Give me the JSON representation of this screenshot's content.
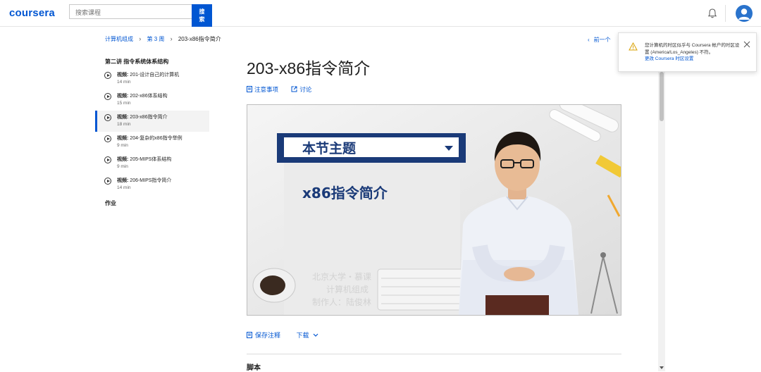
{
  "header": {
    "logo": "coursera",
    "search_placeholder": "搜索课程",
    "search_button": "搜索"
  },
  "breadcrumb": {
    "items": [
      "计算机组成",
      "第 3 周",
      "203-x86指令简介"
    ],
    "prev": "前一个"
  },
  "sidebar": {
    "section_title": "第二讲 指令系统体系结构",
    "items": [
      {
        "prefix": "视频:",
        "label": "201-设计自己的计算机",
        "duration": "14 min"
      },
      {
        "prefix": "视频:",
        "label": "202-x86体系结构",
        "duration": "15 min"
      },
      {
        "prefix": "视频:",
        "label": "203-x86指令简介",
        "duration": "18 min"
      },
      {
        "prefix": "视频:",
        "label": "204-复杂的x86指令举例",
        "duration": "9 min"
      },
      {
        "prefix": "视频:",
        "label": "205-MIPS体系结构",
        "duration": "9 min"
      },
      {
        "prefix": "视频:",
        "label": "206-MIPS指令简介",
        "duration": "14 min"
      }
    ],
    "homework": "作业"
  },
  "main": {
    "title": "203-x86指令简介",
    "notes_link": "注意事项",
    "discuss_link": "讨论",
    "save_notes": "保存注释",
    "download": "下载",
    "transcript": "脚本"
  },
  "video": {
    "banner": "本节主题",
    "topic": "x86指令简介",
    "credit_lines": [
      "北京大学・慕课",
      "计算机组成",
      "制作人：陆俊林"
    ]
  },
  "toast": {
    "message": "您计算机的时区似乎与 Coursera 帐户的时区设置 (America/Los_Angeles) 不符。",
    "link": "更改 Coursera 时区设置"
  },
  "colors": {
    "brand": "#0056d2",
    "banner_border": "#1a3a78"
  }
}
